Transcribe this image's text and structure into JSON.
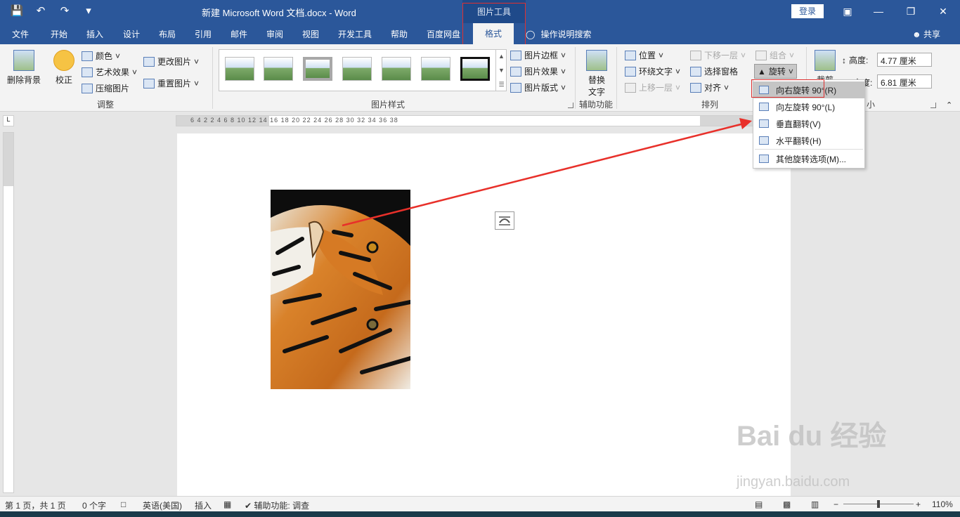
{
  "title_bar": {
    "document_title": "新建 Microsoft Word 文档.docx  -  Word",
    "context_tool": "图片工具",
    "login": "登录",
    "qat_icons": [
      "save-icon",
      "undo-icon",
      "redo-icon",
      "customize-icon"
    ]
  },
  "tabs": [
    "文件",
    "开始",
    "插入",
    "设计",
    "布局",
    "引用",
    "邮件",
    "审阅",
    "视图",
    "开发工具",
    "帮助",
    "百度网盘"
  ],
  "active_tab": "格式",
  "help_search": "操作说明搜索",
  "share": "共享",
  "ribbon": {
    "adjust": {
      "remove_bg": "删除背景",
      "correct": "校正",
      "color": "颜色",
      "artistic": "艺术效果",
      "compress": "压缩图片",
      "change_pic": "更改图片",
      "reset_pic": "重置图片",
      "group_label": "调整"
    },
    "styles": {
      "group_label": "图片样式",
      "border": "图片边框",
      "effects": "图片效果",
      "layout": "图片版式"
    },
    "accessibility": {
      "alt_text_1": "替换",
      "alt_text_2": "文字",
      "group_label": "辅助功能"
    },
    "arrange": {
      "position": "位置",
      "wrap_text": "环绕文字",
      "bring_forward": "上移一层",
      "send_backward": "下移一层",
      "selection_pane": "选择窗格",
      "align": "对齐",
      "group": "组合",
      "rotate": "旋转",
      "group_label": "排列"
    },
    "size": {
      "crop": "裁剪",
      "height_label": "高度:",
      "height_value": "4.77 厘米",
      "width_label": "宽度:",
      "width_value": "6.81 厘米",
      "group_label": "小"
    }
  },
  "rotate_menu": [
    {
      "label": "向右旋转 90°(R)",
      "icon": "rotate-right-icon"
    },
    {
      "label": "向左旋转 90°(L)",
      "icon": "rotate-left-icon"
    },
    {
      "label": "垂直翻转(V)",
      "icon": "flip-vertical-icon"
    },
    {
      "label": "水平翻转(H)",
      "icon": "flip-horizontal-icon"
    },
    {
      "label": "其他旋转选项(M)...",
      "icon": "more-rotation-icon"
    }
  ],
  "ruler_numbers": "6  4  2     2  4  6  8  10  12  14  16  18  20  22  24  26  28  30  32  34  36  38",
  "status_bar": {
    "page": "第 1 页，共 1 页",
    "words": "0 个字",
    "language": "英语(美国)",
    "insert_mode": "插入",
    "accessibility": "辅助功能: 调查",
    "zoom": "110%"
  },
  "watermark": {
    "brand": "Bai du 经验",
    "url": "jingyan.baidu.com"
  },
  "colors": {
    "title_blue": "#2b579a",
    "highlight_red": "#e03030",
    "arrow_red": "#e8302a"
  }
}
